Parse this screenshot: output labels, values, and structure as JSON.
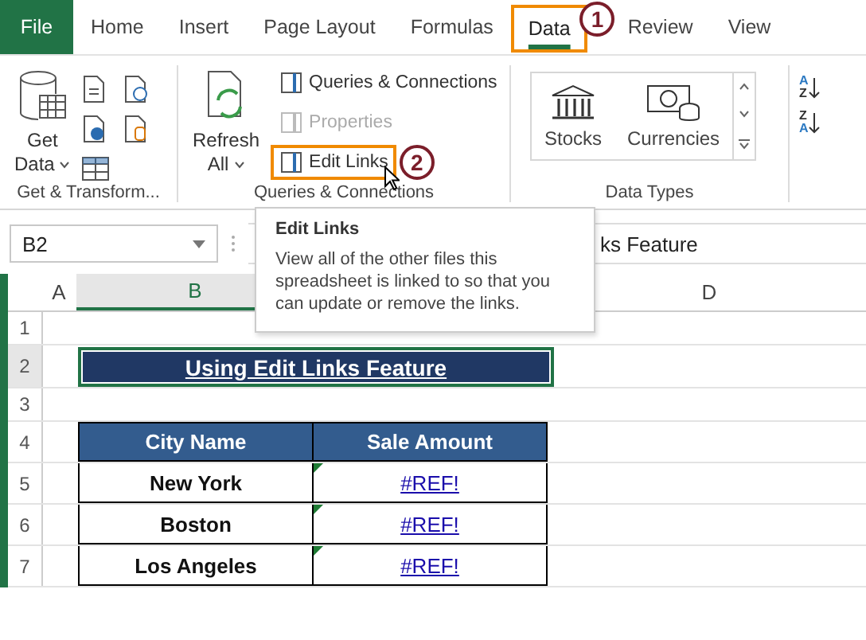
{
  "tabs": [
    {
      "label": "File",
      "kind": "file",
      "selected": false,
      "highlighted": false
    },
    {
      "label": "Home",
      "kind": "tab",
      "selected": false,
      "highlighted": false
    },
    {
      "label": "Insert",
      "kind": "tab",
      "selected": false,
      "highlighted": false
    },
    {
      "label": "Page Layout",
      "kind": "tab",
      "selected": false,
      "highlighted": false
    },
    {
      "label": "Formulas",
      "kind": "tab",
      "selected": false,
      "highlighted": false
    },
    {
      "label": "Data",
      "kind": "tab",
      "selected": true,
      "highlighted": true,
      "step": "1"
    },
    {
      "label": "Review",
      "kind": "tab",
      "selected": false,
      "highlighted": false
    },
    {
      "label": "View",
      "kind": "tab",
      "selected": false,
      "highlighted": false
    }
  ],
  "ribbon": {
    "get_transform": {
      "button_lines": [
        "Get",
        "Data"
      ],
      "label": "Get & Transform..."
    },
    "queries": {
      "refresh_lines": [
        "Refresh",
        "All"
      ],
      "items": [
        {
          "label": "Queries & Connections",
          "disabled": false,
          "highlighted": false
        },
        {
          "label": "Properties",
          "disabled": true,
          "highlighted": false
        },
        {
          "label": "Edit Links",
          "disabled": false,
          "highlighted": true,
          "step": "2"
        }
      ],
      "label": "Queries & Connections"
    },
    "data_types": {
      "items": [
        "Stocks",
        "Currencies"
      ],
      "label": "Data Types"
    },
    "sort": [
      {
        "top": "A",
        "bottom": "Z"
      },
      {
        "top": "Z",
        "bottom": "A"
      }
    ]
  },
  "name_box": "B2",
  "formula": "ks Feature",
  "tooltip": {
    "title": "Edit Links",
    "text": "View all of the other files this spreadsheet is linked to so that you can update or remove the links."
  },
  "columns": [
    "A",
    "B",
    "D"
  ],
  "rows": [
    "1",
    "2",
    "3",
    "4",
    "5",
    "6",
    "7"
  ],
  "title": "Using Edit Links Feature",
  "table": {
    "columns": [
      "City Name",
      "Sale Amount"
    ],
    "rows": [
      {
        "city": "New York",
        "amount": "#REF!"
      },
      {
        "city": "Boston",
        "amount": "#REF!"
      },
      {
        "city": "Los Angeles",
        "amount": "#REF!"
      }
    ]
  }
}
